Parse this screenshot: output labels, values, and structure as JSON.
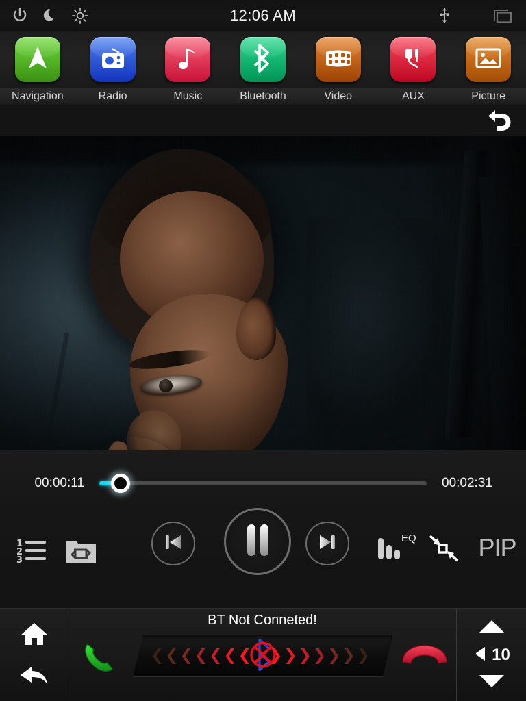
{
  "status_bar": {
    "clock": "12:06 AM",
    "icons": {
      "power": "power-icon",
      "night": "moon-night-mode-icon",
      "brightness": "brightness-sun-icon",
      "usb": "usb-icon",
      "windows": "multi-window-icon"
    }
  },
  "app_bar": {
    "apps": [
      {
        "label": "Navigation",
        "icon": "navigation-arrow-icon",
        "color": "#5cc72b",
        "color2": "#3d9a16"
      },
      {
        "label": "Radio",
        "icon": "radio-icon",
        "color": "#3b6fe8",
        "color2": "#1a3fc4"
      },
      {
        "label": "Music",
        "icon": "music-note-icon",
        "color": "#ee4d63",
        "color2": "#d02243"
      },
      {
        "label": "Bluetooth",
        "icon": "bluetooth-icon",
        "color": "#19c47e",
        "color2": "#049a5e"
      },
      {
        "label": "Video",
        "icon": "film-strip-icon",
        "color": "#d4711c",
        "color2": "#a84a07"
      },
      {
        "label": "AUX",
        "icon": "aux-plug-icon",
        "color": "#ef3246",
        "color2": "#c20d28"
      },
      {
        "label": "Picture",
        "icon": "photo-icon",
        "color": "#d9781f",
        "color2": "#ab4f06"
      }
    ]
  },
  "nav_bar": {
    "back_label": "back-return-icon"
  },
  "player": {
    "current_time": "00:00:11",
    "total_time": "00:02:31",
    "progress_percent": 6.5,
    "accent_color": "#0ed8f0",
    "state": "playing",
    "controls": {
      "playlist": "playlist-123-icon",
      "repeat": "repeat-folder-icon",
      "previous": "previous-track-icon",
      "play_pause": "pause-icon",
      "next": "next-track-icon",
      "eq_label": "EQ",
      "eq": "equalizer-icon",
      "shrink": "shrink-screen-icon",
      "pip_label": "PIP"
    }
  },
  "bottom_bar": {
    "home": "home-icon",
    "back": "back-arrow-icon",
    "bt_status": "BT Not Conneted!",
    "call_answer": "phone-answer-icon",
    "call_end": "phone-hangup-icon",
    "bt_disconnected_icon": "bluetooth-disconnected-icon",
    "volume_value": "10",
    "volume_icon": "speaker-icon",
    "volume_up": "volume-up-arrow",
    "volume_down": "volume-down-arrow"
  }
}
